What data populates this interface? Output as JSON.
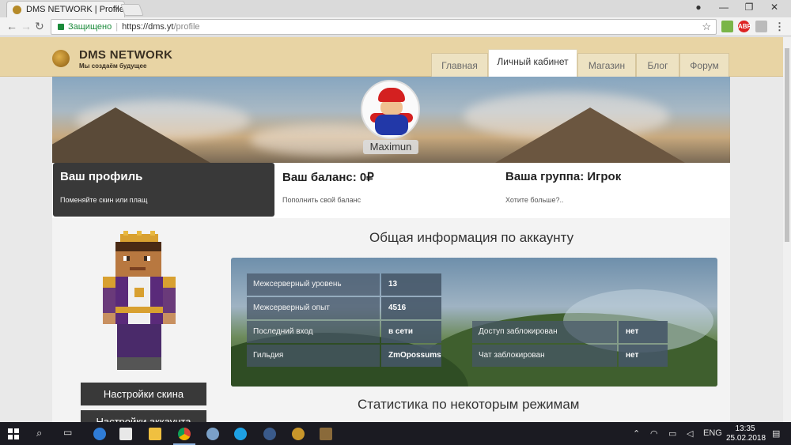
{
  "browser": {
    "tab_title": "DMS NETWORK | Profile",
    "tab_close": "×",
    "secure_label": "Защищено",
    "url_scheme_host": "https://dms.yt",
    "url_path": "/profile",
    "extensions": [
      "ABP"
    ]
  },
  "site": {
    "logo_title": "DMS NETWORK",
    "logo_subtitle": "Мы создаём будущее",
    "nav": [
      "Главная",
      "Личный кабинет",
      "Магазин",
      "Блог",
      "Форум"
    ],
    "active_nav": "Личный кабинет"
  },
  "profile": {
    "username": "Maximun"
  },
  "cards": [
    {
      "title": "Ваш профиль",
      "subtitle": "Поменяйте скин или плащ"
    },
    {
      "title": "Ваш баланс: 0₽",
      "subtitle": "Пополнить свой баланс"
    },
    {
      "title": "Ваша группа: Игрок",
      "subtitle": "Хотите больше?.."
    }
  ],
  "account": {
    "section_title": "Общая информация по аккаунту",
    "left_stats": [
      {
        "label": "Межсерверный уровень",
        "value": "13"
      },
      {
        "label": "Межсерверный опыт",
        "value": "4516"
      },
      {
        "label": "Последний вход",
        "value": "в сети"
      },
      {
        "label": "Гильдия",
        "value": "ZmOpossums"
      }
    ],
    "right_stats": [
      {
        "label": "Доступ заблокирован",
        "value": "нет"
      },
      {
        "label": "Чат заблокирован",
        "value": "нет"
      }
    ]
  },
  "buttons": {
    "skin_settings": "Настройки скина",
    "account_settings": "Настройки аккаунта"
  },
  "modes": {
    "section_title": "Статистика по некоторым режимам"
  },
  "taskbar": {
    "language": "ENG",
    "time": "13:35",
    "date": "25.02.2018"
  },
  "colors": {
    "header_bg": "#e8d4a4",
    "dark_card": "#393939",
    "taskbar": "#1b1b22"
  }
}
